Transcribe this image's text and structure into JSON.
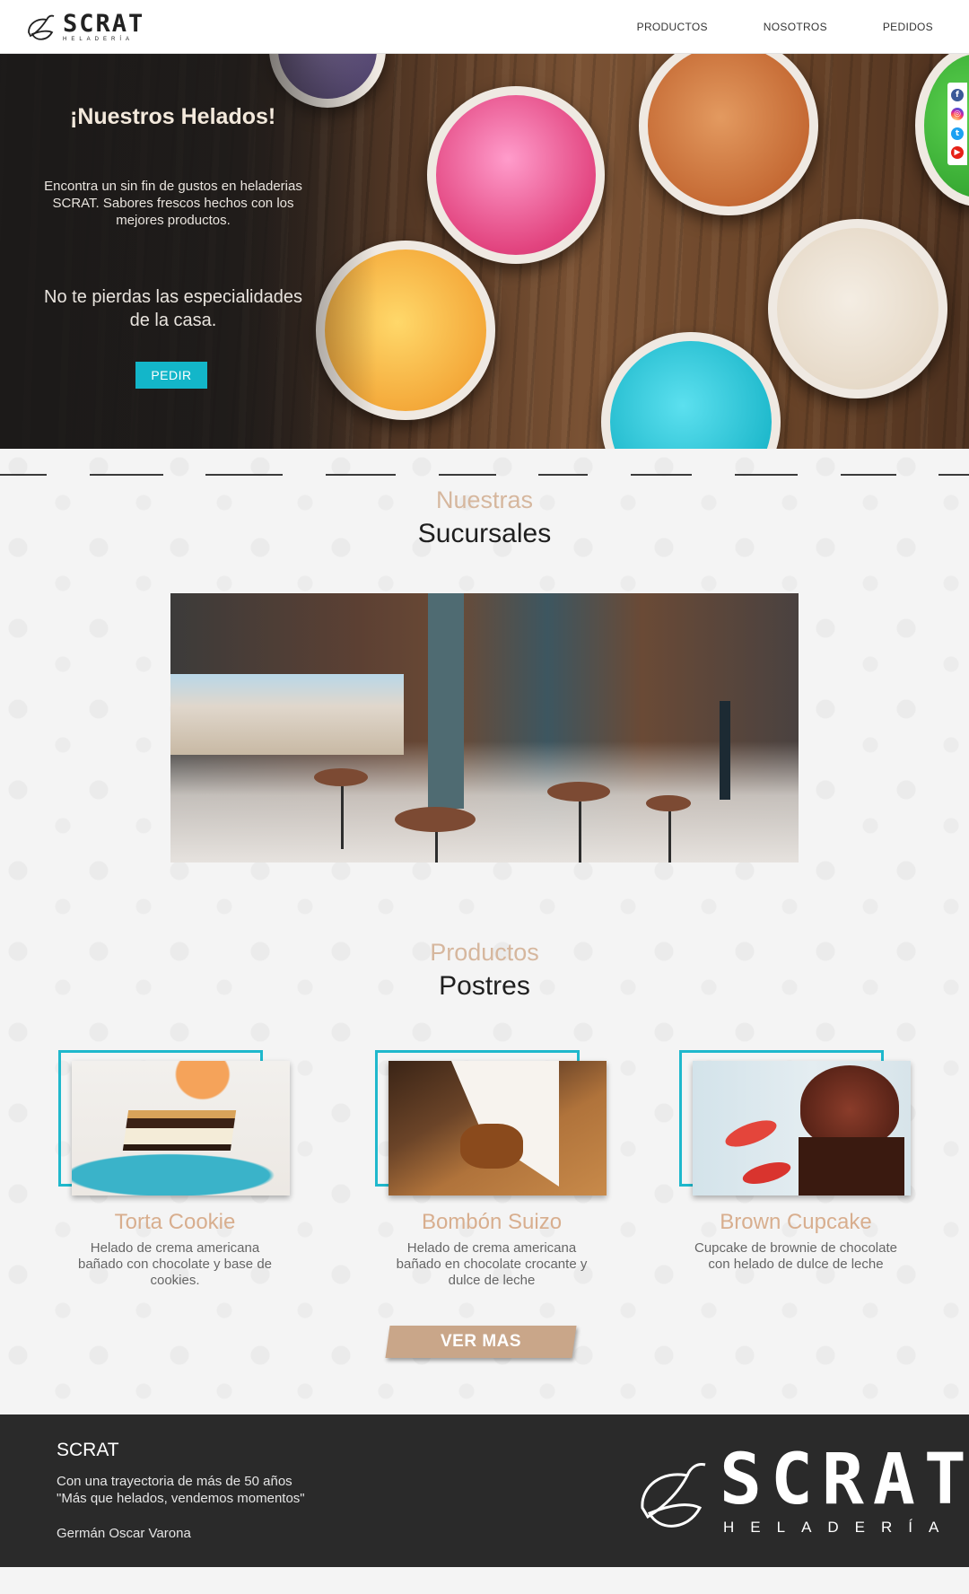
{
  "header": {
    "logo_word": "SCRAT",
    "logo_sub": "HELADERÍA",
    "nav": [
      "PRODUCTOS",
      "NOSOTROS",
      "PEDIDOS"
    ]
  },
  "hero": {
    "title": "¡Nuestros Helados!",
    "text": "Encontra un sin fin de gustos en heladerias SCRAT. Sabores frescos hechos con los mejores productos.",
    "subtext": "No te pierdas las especialidades de la casa.",
    "button": "PEDIR"
  },
  "social": [
    "facebook-icon",
    "instagram-icon",
    "twitter-icon",
    "youtube-icon"
  ],
  "sucursales": {
    "kicker": "Nuestras",
    "title": "Sucursales"
  },
  "productos": {
    "kicker": "Productos",
    "title": "Postres",
    "items": [
      {
        "name": "Torta Cookie",
        "desc": "Helado de crema americana bañado con chocolate y base de cookies."
      },
      {
        "name": "Bombón Suizo",
        "desc": "Helado de crema americana bañado en chocolate crocante y dulce de leche"
      },
      {
        "name": "Brown Cupcake",
        "desc": "Cupcake de brownie de chocolate con helado de dulce de leche"
      }
    ],
    "more_button": "VER MAS"
  },
  "footer": {
    "title": "SCRAT",
    "line1": "Con una trayectoria de más de 50 años",
    "line2": "\"Más que helados, vendemos momentos\"",
    "author": "Germán Oscar Varona",
    "logo_word": "SCRAT",
    "logo_sub": "HELADERÍA"
  },
  "colors": {
    "accent": "#13b6c9",
    "beige": "#d6b79e",
    "footer_bg": "#2a2a2a"
  }
}
